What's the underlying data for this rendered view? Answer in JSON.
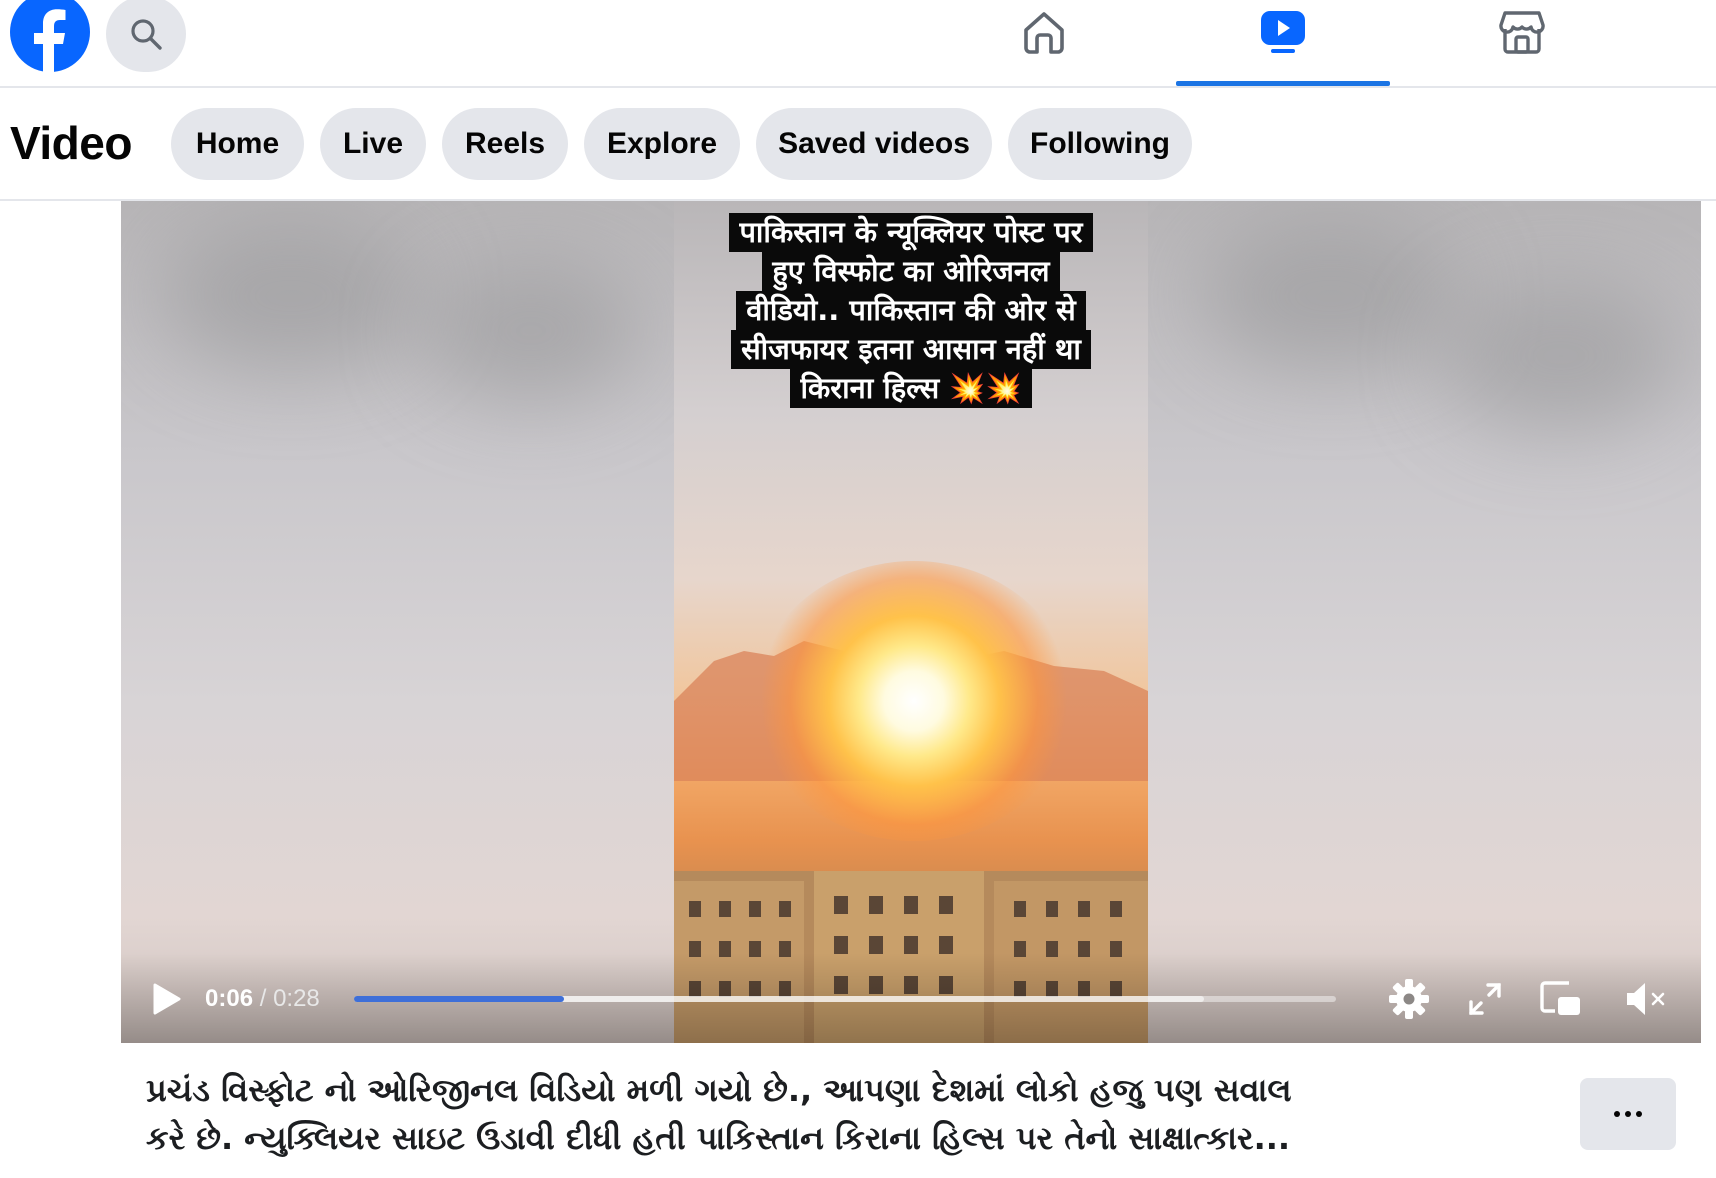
{
  "topbar": {
    "logo": "facebook-logo",
    "search_icon": "search-icon",
    "tabs": [
      {
        "icon": "home-icon",
        "active": false
      },
      {
        "icon": "video-icon",
        "active": true
      },
      {
        "icon": "marketplace-icon",
        "active": false
      }
    ],
    "accent_color": "#1b74e4"
  },
  "video_section": {
    "title": "Video",
    "pills": [
      "Home",
      "Live",
      "Reels",
      "Explore",
      "Saved videos",
      "Following"
    ]
  },
  "player": {
    "overlay_lines": [
      "पाकिस्तान के न्यूक्लियर पोस्ट पर",
      "हुए विस्फोट का ओरिजनल",
      "वीडियो.. पाकिस्तान की ओर से",
      "सीजफायर इतना आसान नहीं था",
      "किराना हिल्स 💥💥"
    ],
    "current_time": "0:06",
    "separator": "/",
    "duration": "0:28",
    "progress_fraction": 0.214,
    "buffered_fraction": 0.866,
    "controls": [
      "play-icon",
      "settings-icon",
      "fullscreen-icon",
      "miniplayer-icon",
      "mute-icon"
    ]
  },
  "post": {
    "caption_lines": [
      "પ્રચંડ વિસ્ફોટ નો ઓરિજીનલ વિડિયો મળી ગયો છે., આપણા દેશમાં લોકો હજુ પણ સવાલ",
      "કરે છે. ન્યુક્લિયર સાઇટ ઉડાવી દીધી હતી પાકિસ્તાન કિરાના હિલ્સ પર તેનો સાક્ષાત્કાર..."
    ],
    "more_icon": "more-options-icon"
  }
}
